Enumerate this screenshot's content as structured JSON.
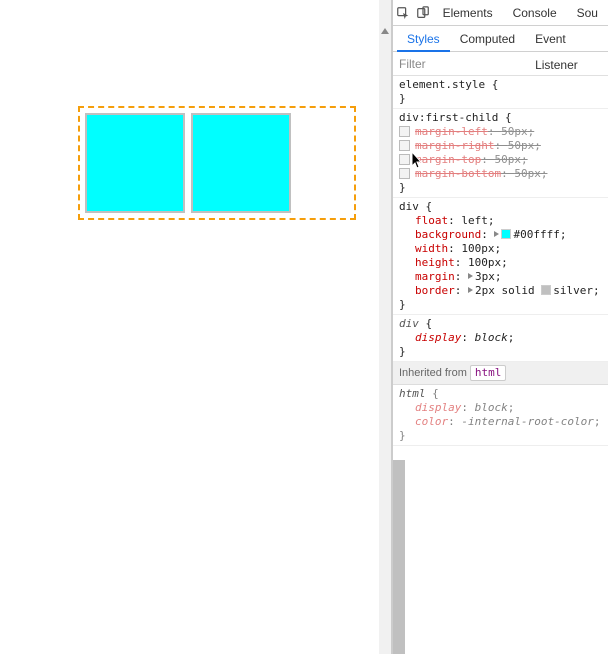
{
  "toptabs": [
    "Elements",
    "Console",
    "Sou"
  ],
  "subtabs": [
    "Styles",
    "Computed",
    "Event Listener"
  ],
  "filter_placeholder": "Filter",
  "inherited_label": "Inherited from",
  "inherited_tag": "html",
  "rules": [
    {
      "selector": "element.style",
      "props": []
    },
    {
      "selector": "div:first-child",
      "props": [
        {
          "name": "margin-left",
          "value": "50px",
          "overridden": true,
          "checkbox": true
        },
        {
          "name": "margin-right",
          "value": "50px",
          "overridden": true,
          "checkbox": true
        },
        {
          "name": "margin-top",
          "value": "50px",
          "overridden": true,
          "checkbox": true
        },
        {
          "name": "margin-bottom",
          "value": "50px",
          "overridden": true,
          "checkbox": true
        }
      ]
    },
    {
      "selector": "div",
      "props": [
        {
          "name": "float",
          "value": "left"
        },
        {
          "name": "background",
          "value": "#00ffff",
          "swatch": "cyan",
          "expand": true
        },
        {
          "name": "width",
          "value": "100px"
        },
        {
          "name": "height",
          "value": "100px"
        },
        {
          "name": "margin",
          "value": "3px",
          "expand": true
        },
        {
          "name": "border",
          "value": "2px solid silver",
          "swatch": "silver",
          "expand": true,
          "swatch_before": "silver"
        }
      ]
    },
    {
      "selector": "div",
      "ua": true,
      "props": [
        {
          "name": "display",
          "value": "block",
          "italic": true
        }
      ]
    },
    {
      "selector": "html",
      "ua": true,
      "inherited": true,
      "props": [
        {
          "name": "display",
          "value": "block",
          "italic": true
        },
        {
          "name": "color",
          "value": "-internal-root-color",
          "italic": true
        }
      ]
    }
  ]
}
